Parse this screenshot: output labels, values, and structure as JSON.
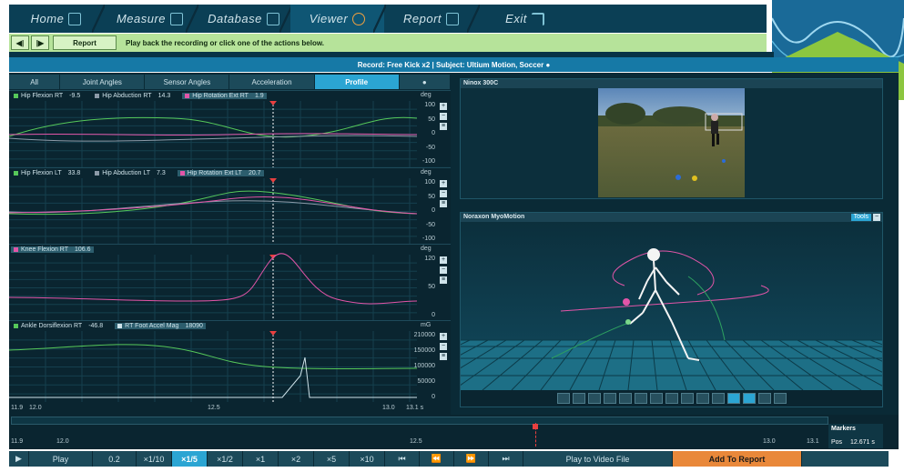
{
  "nav": {
    "tabs": [
      {
        "label": "Home",
        "icon": "home-icon"
      },
      {
        "label": "Measure",
        "icon": "measure-icon"
      },
      {
        "label": "Database",
        "icon": "database-icon"
      },
      {
        "label": "Viewer",
        "icon": "viewer-icon",
        "active": true
      },
      {
        "label": "Report",
        "icon": "report-icon"
      },
      {
        "label": "Exit",
        "icon": "exit-icon"
      }
    ]
  },
  "toolbar": {
    "back_icon": "step-back-icon",
    "play_icon": "step-forward-icon",
    "report_label": "Report",
    "message": "Play back the recording or click one of the actions below."
  },
  "record_title": "Record: Free Kick x2 | Subject: Ultium Motion, Soccer ●",
  "tabs": [
    "All",
    "Joint Angles",
    "Sensor Angles",
    "Acceleration",
    "Profile",
    "●"
  ],
  "active_tab": "Profile",
  "plots": [
    {
      "legend": [
        {
          "label": "Hip Flexion RT",
          "value": "-9.5",
          "color": "#56c85a"
        },
        {
          "label": "Hip Abduction RT",
          "value": "14.3",
          "color": "#8c9aa8"
        },
        {
          "label": "Hip Rotation Ext RT",
          "value": "1.9",
          "color": "#e255a8",
          "hl": true
        }
      ],
      "unit": "deg",
      "ticks": [
        "100",
        "50",
        "0",
        "-50",
        "-100"
      ]
    },
    {
      "legend": [
        {
          "label": "Hip Flexion LT",
          "value": "33.8",
          "color": "#56c85a"
        },
        {
          "label": "Hip Abduction LT",
          "value": "7.3",
          "color": "#8c9aa8"
        },
        {
          "label": "Hip Rotation Ext LT",
          "value": "20.7",
          "color": "#e255a8",
          "hl": true
        }
      ],
      "unit": "deg",
      "ticks": [
        "100",
        "50",
        "0",
        "-50",
        "-100"
      ]
    },
    {
      "legend": [
        {
          "label": "Knee Flexion RT",
          "value": "106.6",
          "color": "#e255a8",
          "hl": true
        }
      ],
      "unit": "deg",
      "ticks": [
        "120",
        "50",
        "0"
      ]
    },
    {
      "legend": [
        {
          "label": "Ankle Dorsiflexion RT",
          "value": "-46.8",
          "color": "#56c85a"
        },
        {
          "label": "RT Foot Accel Mag",
          "value": "18090",
          "color": "#cfe3ea",
          "hl": true
        }
      ],
      "unit": "mG",
      "ticks": [
        "210000",
        "150000",
        "100000",
        "50000",
        "0"
      ]
    }
  ],
  "time_axis": {
    "start": "11.9",
    "ticks": [
      "12.0",
      "12.5",
      "13.0"
    ],
    "end": "13.1 s"
  },
  "video_panel": {
    "title": "Ninox 300C"
  },
  "mocap_panel": {
    "title": "Noraxon MyoMotion",
    "tools_label": "Tools"
  },
  "timeline": {
    "start": "11.9",
    "ticks": [
      "12.0",
      "12.5",
      "13.0"
    ],
    "end": "13.1",
    "markers_label": "Markers",
    "pos_label": "Pos",
    "pos_value": "12.671 s"
  },
  "bottom": {
    "play_label": "Play",
    "speeds": [
      "0.2",
      "×1/10",
      "×1/5",
      "×1/2",
      "×1",
      "×2",
      "×5",
      "×10"
    ],
    "active_speed": "×1/5",
    "play_to_video": "Play to Video File",
    "add_to_report": "Add To Report"
  }
}
